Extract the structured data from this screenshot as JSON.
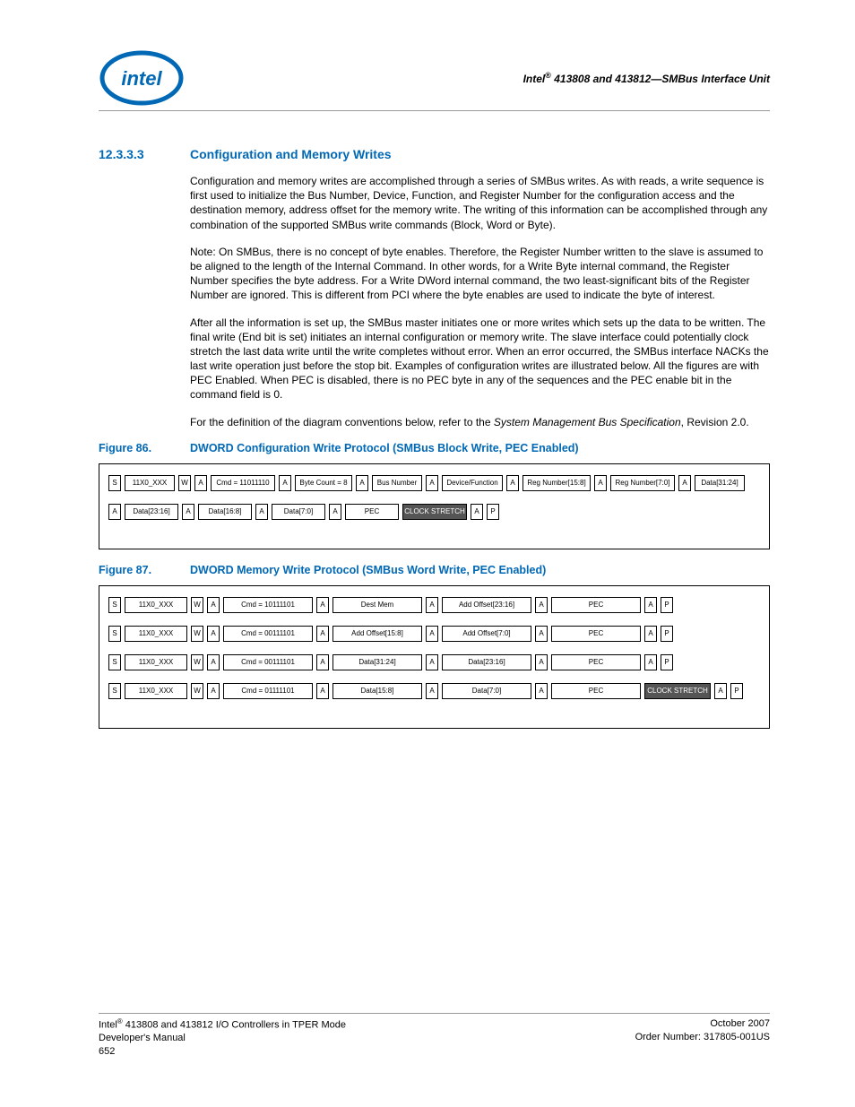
{
  "header": {
    "title_html": "Intel® 413808 and 413812—SMBus Interface Unit"
  },
  "section": {
    "number": "12.3.3.3",
    "title": "Configuration and Memory Writes"
  },
  "paragraphs": {
    "p1": "Configuration and memory writes are accomplished through a series of SMBus writes. As with reads, a write sequence is first used to initialize the Bus Number, Device, Function, and Register Number for the configuration access and the destination memory, address offset for the memory write. The writing of this information can be accomplished through any combination of the supported SMBus write commands (Block, Word or Byte).",
    "p2": "Note: On SMBus, there is no concept of byte enables. Therefore, the Register Number written to the slave is assumed to be aligned to the length of the Internal Command. In other words, for a Write Byte internal command, the Register Number specifies the byte address. For a Write DWord internal command, the two least-significant bits of the Register Number are ignored. This is different from PCI where the byte enables are used to indicate the byte of interest.",
    "p3": "After all the information is set up, the SMBus master initiates one or more writes which sets up the data to be written. The final write (End bit is set) initiates an internal configuration or memory write. The slave interface could potentially clock stretch the last data write until the write completes without error. When an error occurred, the SMBus interface NACKs the last write operation just before the stop bit. Examples of configuration writes are illustrated below. All the figures are with PEC Enabled. When PEC is disabled, there is no PEC byte in any of the sequences and the PEC enable bit in the command field is 0.",
    "p4a": "For the definition of the diagram conventions below, refer to the ",
    "p4b": "System Management Bus Specification",
    "p4c": ", Revision 2.0."
  },
  "figures": {
    "f86": {
      "label": "Figure 86.",
      "title": "DWORD Configuration Write Protocol (SMBus Block Write, PEC Enabled)"
    },
    "f87": {
      "label": "Figure 87.",
      "title": "DWORD Memory Write Protocol (SMBus Word Write, PEC Enabled)"
    }
  },
  "fig86": {
    "row1": [
      "S",
      "11X0_XXX",
      "W",
      "A",
      "Cmd = 11011110",
      "A",
      "Byte Count = 8",
      "A",
      "Bus Number",
      "A",
      "Device/Function",
      "A",
      "Reg Number[15:8]",
      "A",
      "Reg Number[7:0]",
      "A",
      "Data[31:24]"
    ],
    "row2": [
      "A",
      "Data[23:16]",
      "A",
      "Data[16:8]",
      "A",
      "Data[7:0]",
      "A",
      "PEC",
      "CLOCK STRETCH",
      "A",
      "P"
    ]
  },
  "fig87": {
    "row1": [
      "S",
      "11X0_XXX",
      "W",
      "A",
      "Cmd = 10111101",
      "A",
      "Dest Mem",
      "A",
      "Add Offset[23:16]",
      "A",
      "PEC",
      "A",
      "P"
    ],
    "row2": [
      "S",
      "11X0_XXX",
      "W",
      "A",
      "Cmd = 00111101",
      "A",
      "Add Offset[15:8]",
      "A",
      "Add Offset[7:0]",
      "A",
      "PEC",
      "A",
      "P"
    ],
    "row3": [
      "S",
      "11X0_XXX",
      "W",
      "A",
      "Cmd = 00111101",
      "A",
      "Data[31:24]",
      "A",
      "Data[23:16]",
      "A",
      "PEC",
      "A",
      "P"
    ],
    "row4": [
      "S",
      "11X0_XXX",
      "W",
      "A",
      "Cmd = 01111101",
      "A",
      "Data[15:8]",
      "A",
      "Data[7:0]",
      "A",
      "PEC",
      "CLOCK STRETCH",
      "A",
      "P"
    ]
  },
  "footer": {
    "left1": "Intel® 413808 and 413812 I/O Controllers in TPER Mode",
    "left2": "Developer's Manual",
    "left3": "652",
    "right1": "October 2007",
    "right2": "Order Number: 317805-001US"
  }
}
